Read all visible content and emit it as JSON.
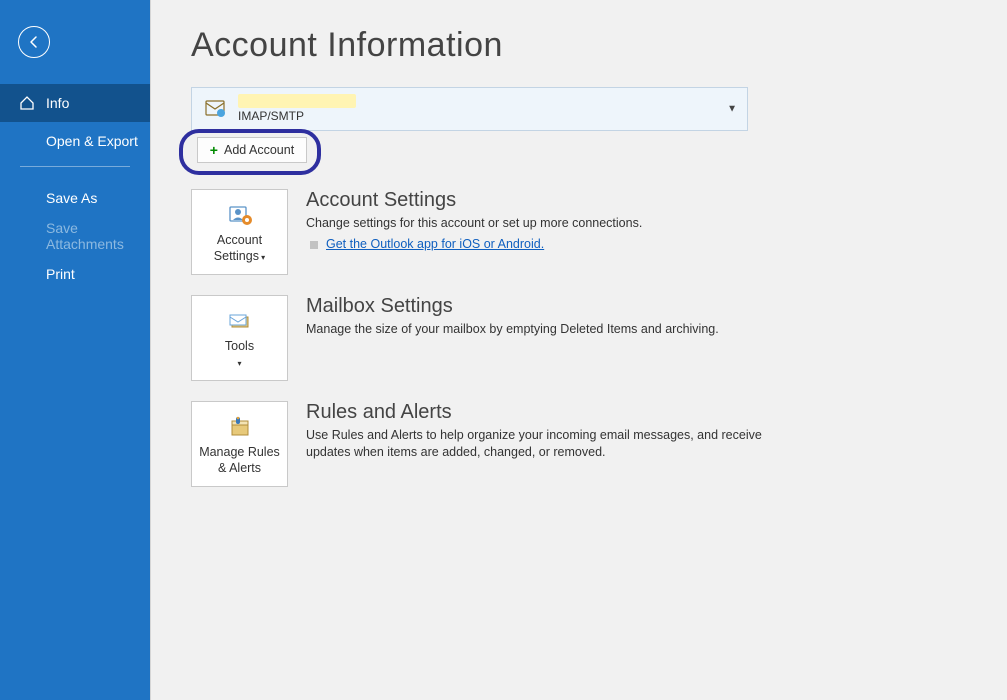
{
  "header": {
    "title": "Account Information"
  },
  "sidebar": {
    "items": [
      {
        "label": "Info"
      },
      {
        "label": "Open & Export"
      },
      {
        "label": "Save As"
      },
      {
        "label": "Save Attachments"
      },
      {
        "label": "Print"
      }
    ]
  },
  "account": {
    "type": "IMAP/SMTP",
    "add_label": "Add Account"
  },
  "sections": {
    "settings": {
      "button_line1": "Account",
      "button_line2": "Settings",
      "title": "Account Settings",
      "desc": "Change settings for this account or set up more connections.",
      "link": "Get the Outlook app for iOS or Android."
    },
    "mailbox": {
      "button_line1": "Tools",
      "title": "Mailbox Settings",
      "desc": "Manage the size of your mailbox by emptying Deleted Items and archiving."
    },
    "rules": {
      "button_line1": "Manage Rules",
      "button_line2": "& Alerts",
      "title": "Rules and Alerts",
      "desc": "Use Rules and Alerts to help organize your incoming email messages, and receive updates when items are added, changed, or removed."
    }
  }
}
